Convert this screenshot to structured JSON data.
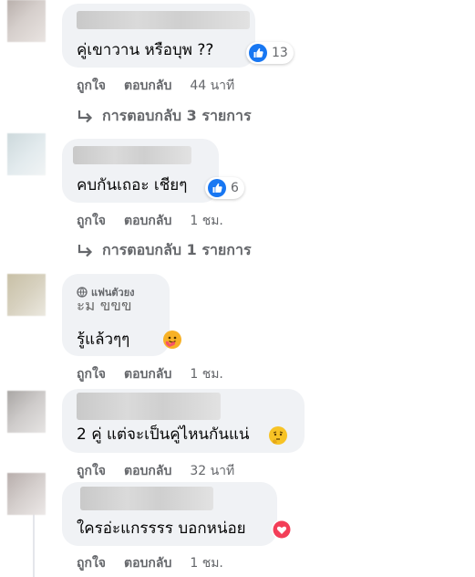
{
  "comments": [
    {
      "text": "คู่เขาวาน หรือบุพ ??",
      "reaction": {
        "icon": "like-icon",
        "count": "13"
      },
      "like_label": "ถูกใจ",
      "reply_label": "ตอบกลับ",
      "time": "44 นาที",
      "replies_label": "การตอบกลับ 3 รายการ"
    },
    {
      "text": "คบกันเถอะ เชียๆ",
      "reaction": {
        "icon": "like-icon",
        "count": "6"
      },
      "like_label": "ถูกใจ",
      "reply_label": "ตอบกลับ",
      "time": "1 ชม.",
      "replies_label": "การตอบกลับ 1 รายการ"
    },
    {
      "badge": "แฟนตัวยง",
      "line1": "ะม ขขข",
      "text": "รู้แล้วๆๆ",
      "reaction": {
        "icon": "care-icon"
      },
      "like_label": "ถูกใจ",
      "reply_label": "ตอบกลับ",
      "time": "1 ชม."
    },
    {
      "text": "2 คู่ แต่จะเป็นคู่ไหนกันแน่",
      "reaction": {
        "icon": "thinking-emoji-icon"
      },
      "like_label": "ถูกใจ",
      "reply_label": "ตอบกลับ",
      "time": "32 นาที"
    },
    {
      "text": "ใครอ่ะแกรรรร บอกหน่อย",
      "reaction": {
        "icon": "love-icon"
      },
      "like_label": "ถูกใจ",
      "reply_label": "ตอบกลับ",
      "time": "1 ชม."
    }
  ],
  "colors": {
    "bubble": "#f0f2f5",
    "meta_text": "#65676b",
    "like_blue": "#1877f2",
    "love_red": "#f33e58"
  }
}
